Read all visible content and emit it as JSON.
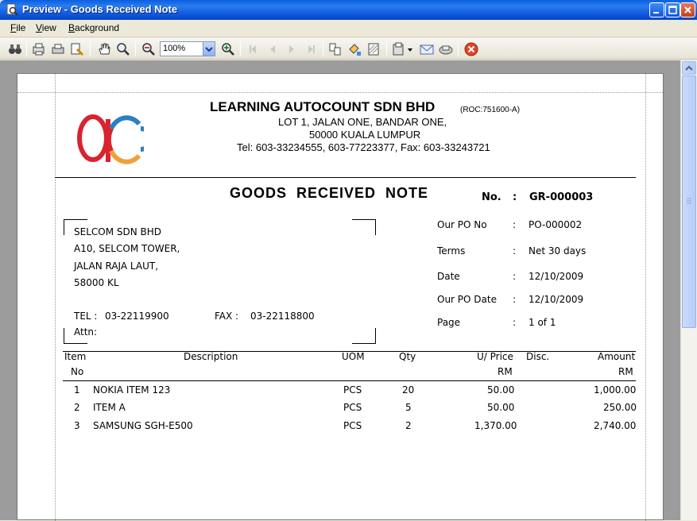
{
  "window": {
    "title": "Preview - Goods Received Note",
    "app_icon": "preview-icon"
  },
  "menu": {
    "items": [
      {
        "label": "File",
        "accel": "F",
        "rest": "ile"
      },
      {
        "label": "View",
        "accel": "V",
        "rest": "iew"
      },
      {
        "label": "Background",
        "accel": "B",
        "rest": "ackground"
      }
    ]
  },
  "toolbar": {
    "zoom": "100%",
    "icons": [
      "binoculars-icon",
      "page-setup-icon",
      "print-icon",
      "print-options-icon",
      "hand-icon",
      "magnifier-icon",
      "zoom-out-icon",
      "zoom-in-icon",
      "first-page-icon",
      "prev-page-icon",
      "next-page-icon",
      "last-page-icon",
      "multi-page-icon",
      "background-color-icon",
      "watermark-icon",
      "export-icon",
      "email-icon",
      "send-icon",
      "close-preview-icon"
    ]
  },
  "document": {
    "company": "LEARNING AUTOCOUNT SDN BHD",
    "roc": "(ROC:751600-A)",
    "address1": "LOT 1, JALAN ONE,  BANDAR ONE,",
    "address2": "50000  KUALA LUMPUR",
    "contact": "Tel:  603-33234555,  603-77223377,  Fax:  603-33243721",
    "title": "GOODS  RECEIVED  NOTE",
    "no_label": "No.",
    "no_value": "GR-000003",
    "supplier": {
      "name": "SELCOM SDN BHD",
      "line1": "A10, SELCOM TOWER,",
      "line2": "JALAN RAJA LAUT,",
      "line3": "58000 KL",
      "tel_label": "TEL :",
      "tel": "03-22119900",
      "fax_label": "FAX :",
      "fax": "03-22118800",
      "attn_label": "Attn:"
    },
    "info": [
      {
        "label": "Our PO No",
        "colon": ":",
        "value": "PO-000002"
      },
      {
        "label": "Terms",
        "colon": ":",
        "value": "Net 30 days"
      },
      {
        "label": "Date",
        "colon": ":",
        "value": "12/10/2009"
      },
      {
        "label": "Our PO Date",
        "colon": ":",
        "value": "12/10/2009"
      },
      {
        "label": "Page",
        "colon": ":",
        "value": "1 of 1"
      }
    ],
    "columns": {
      "item": "Item",
      "no": "No",
      "description": "Description",
      "uom": "UOM",
      "qty": "Qty",
      "uprice": "U/ Price",
      "uprice_unit": "RM",
      "disc": "Disc.",
      "amount": "Amount",
      "amount_unit": "RM"
    },
    "rows": [
      {
        "no": "1",
        "description": "NOKIA ITEM 123",
        "uom": "PCS",
        "qty": "20",
        "uprice": "50.00",
        "disc": "",
        "amount": "1,000.00"
      },
      {
        "no": "2",
        "description": "ITEM A",
        "uom": "PCS",
        "qty": "5",
        "uprice": "50.00",
        "disc": "",
        "amount": "250.00"
      },
      {
        "no": "3",
        "description": "SAMSUNG SGH-E500",
        "uom": "PCS",
        "qty": "2",
        "uprice": "1,370.00",
        "disc": "",
        "amount": "2,740.00"
      }
    ]
  },
  "colors": {
    "titlebar": "#0a5fe0",
    "logo_red": "#d9232e",
    "logo_orange": "#f0a03a",
    "logo_blue": "#2b7fc3"
  }
}
